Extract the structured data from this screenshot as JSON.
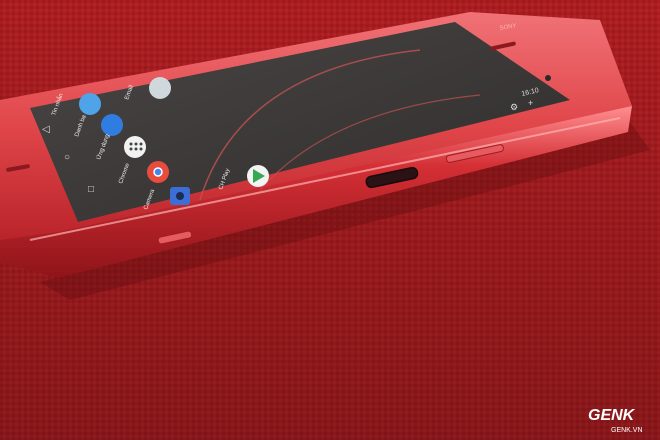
{
  "photo": {
    "subject": "Sony Xperia XZ Premium phone on red fabric",
    "brand_on_phone": "SONY"
  },
  "screen": {
    "status": {
      "time": "16:10"
    },
    "apps": [
      {
        "label": "Tin nhắn",
        "color": "#4fa3e8"
      },
      {
        "label": "Danh bạ",
        "color": "#2f7de1"
      },
      {
        "label": "Ứng dụng",
        "color": "#f2f2f2"
      },
      {
        "label": "Chrome",
        "color": "#e84c3d"
      },
      {
        "label": "Camera",
        "color": "#3b6fd6"
      },
      {
        "label": "Email",
        "color": "#cfd8dc"
      },
      {
        "label": "CH Play",
        "color": "#34a853"
      }
    ]
  },
  "watermark": {
    "brand": "GENK",
    "site": "GENK.VN"
  },
  "colors": {
    "fabric": "#b31f22",
    "phone_body": "#e0464a",
    "screen": "#3b3838"
  }
}
